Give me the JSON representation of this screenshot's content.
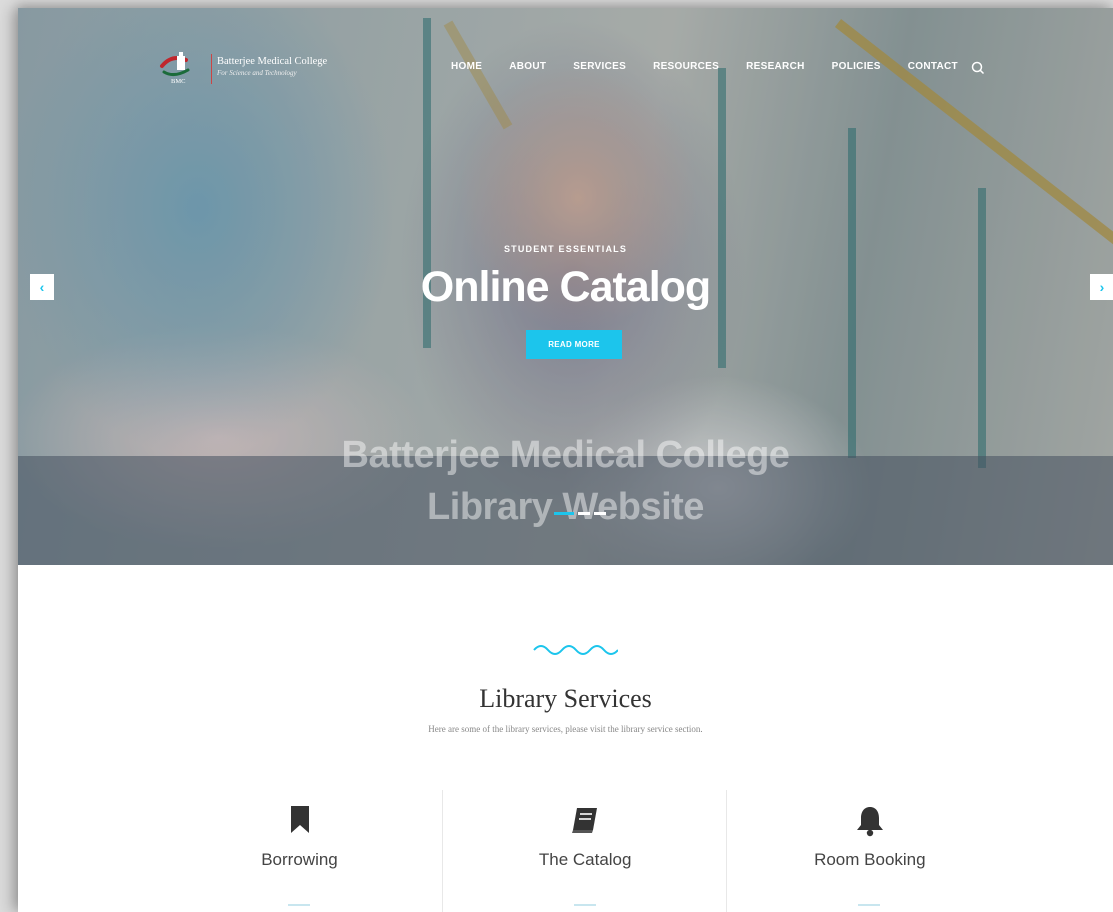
{
  "header": {
    "logo": {
      "name": "Batterjee Medical College",
      "subtitle": "For Science and Technology",
      "abbr": "BMC"
    },
    "nav": [
      "HOME",
      "ABOUT",
      "SERVICES",
      "RESOURCES",
      "RESEARCH",
      "POLICIES",
      "CONTACT"
    ]
  },
  "hero": {
    "eyebrow": "STUDENT ESSENTIALS",
    "title": "Online Catalog",
    "button": "READ MORE",
    "prev_arrow": "‹",
    "next_arrow": "›",
    "band_line1": "Batterjee Medical College",
    "band_line2": "Library Website",
    "slides": 3,
    "active_slide": 1
  },
  "services": {
    "title": "Library Services",
    "subtitle": "Here are some of the library services, please visit the library service section.",
    "items": [
      {
        "label": "Borrowing",
        "icon": "bookmark-icon"
      },
      {
        "label": "The Catalog",
        "icon": "book-icon"
      },
      {
        "label": "Room Booking",
        "icon": "bell-icon"
      }
    ]
  },
  "colors": {
    "accent": "#1cc5ec",
    "text": "#333333"
  }
}
